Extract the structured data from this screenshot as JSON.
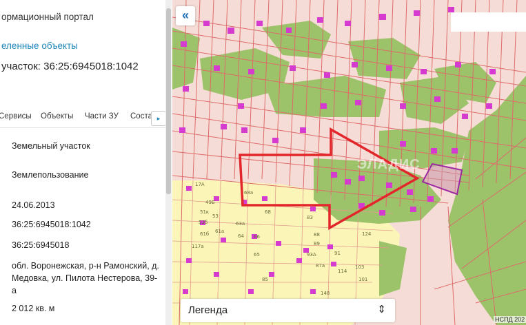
{
  "panel": {
    "portal_title": "ормационный портал",
    "selected_link": "еленные объекты",
    "heading": "участок: 36:25:6945018:1042",
    "tabs": [
      "Сервисы",
      "Объекты",
      "Части ЗУ",
      "Соста"
    ],
    "fields": {
      "type": "Земельный участок",
      "category": "Землепользование",
      "date": "24.06.2013",
      "cadastral_number": "36:25:6945018:1042",
      "block_number": "36:25:6945018",
      "address_line1": "обл. Воронежская, р-н Рамонский, д.",
      "address_line2": "Медовка, ул. Пилота Нестерова, 39-",
      "address_line3": "а",
      "area": "2 012 кв. м"
    }
  },
  "map": {
    "collapse_label": "«",
    "legend_label": "Легенда",
    "legend_chevron": "⇕",
    "attribution": "НСПД 202",
    "watermark": "ЭЛАДИС",
    "colors": {
      "parcel_fill": "#f6dcd6",
      "parcel_line": "#dd6b6b",
      "greenery": "#9cc26a",
      "settlement": "#fbf6b8",
      "building": "#d63bcf",
      "arrow": "#e3262b",
      "selected_parcel": "#9c2aa0"
    },
    "house_numbers": [
      "17А",
      "49Б",
      "51к",
      "53б",
      "61б",
      "53",
      "63а",
      "61а",
      "117а",
      "68а",
      "68",
      "83",
      "85",
      "88",
      "93А",
      "65",
      "64",
      "66",
      "87а",
      "89",
      "91",
      "124",
      "114",
      "148",
      "103",
      "101"
    ]
  }
}
